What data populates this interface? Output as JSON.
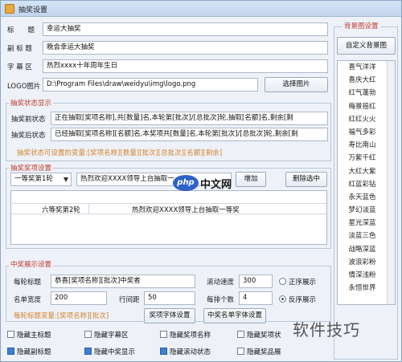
{
  "window": {
    "title": "抽奖设置"
  },
  "basic": {
    "title_label": "标　　题",
    "title_value": "幸运大抽奖",
    "subtitle_label": "副 标 题",
    "subtitle_value": "晚会幸运大抽奖",
    "caption_label": "字 幕 区",
    "caption_value": "热烈xxxx十年周年生日",
    "logo_label": "LOGO图片",
    "logo_path": "D:\\Program Files\\draw\\weidyu\\img\\logo.png",
    "logo_button": "选择图片"
  },
  "draw_status": {
    "group_title": "抽奖状态显示",
    "before_label": "抽奖前状态",
    "before_value": "正在抽取[奖项名称],共[数量]名,本轮第[批次]/[总批次]轮,抽取[名额]名,剩余[剩",
    "after_label": "抽奖后状态",
    "after_value": "已经抽取[奖项名称][名额]名,本奖项共[数量]名,本轮第[批次]/[总批次]轮,剩余[剩",
    "hint": "抽奖状态可设置的变量:[奖项名称][数量][批次][总批次][名额][剩余]"
  },
  "prize_bind": {
    "group_title": "抽奖奖项设置",
    "select_value": "一等奖第1轮",
    "text_value": "热烈欢迎XXXX领导上台抽取一",
    "add_button": "增加",
    "delete_button": "删除选中",
    "table": {
      "col1": "六等奖第2轮",
      "col2": "热烈欢迎XXXX领导上台抽取一等奖"
    }
  },
  "winner_display": {
    "group_title": "中奖展示设置",
    "per_round_label": "每轮标题",
    "per_round_value": "恭喜[奖项名称][批次]中奖者",
    "scroll_speed_label": "滚动速度",
    "scroll_speed_value": "300",
    "name_width_label": "名单宽度",
    "name_width_value": "200",
    "row_spacing_label": "行间距",
    "row_spacing_value": "50",
    "per_row_label": "每排个数",
    "per_row_value": "4",
    "order_asc": "正序展示",
    "order_desc": "反序展示",
    "order_selected": "desc",
    "hint": "每轮标题变量:[奖项名称][批次]",
    "prize_font_button": "奖项字体设置",
    "winner_font_button": "中奖名单字体设置"
  },
  "checks": [
    {
      "label": "隐藏主标题",
      "checked": false
    },
    {
      "label": "隐藏字幕区",
      "checked": false
    },
    {
      "label": "隐藏奖项名称",
      "checked": false
    },
    {
      "label": "隐藏奖项状",
      "checked": false
    },
    {
      "label": "隐藏副标题",
      "checked": true
    },
    {
      "label": "隐藏中奖显示",
      "checked": true
    },
    {
      "label": "隐藏滚动状态",
      "checked": true
    },
    {
      "label": "隐藏奖品展",
      "checked": false
    }
  ],
  "background": {
    "group_title": "背景图设置",
    "custom_button": "自定义背景图",
    "items": [
      "喜气洋洋",
      "喜庆大红",
      "红气蓬勃",
      "梅景摇红",
      "红红火火",
      "福气多彩",
      "寿比南山",
      "万紫千红",
      "大红大紫",
      "红蓝彩钻",
      "永天蓝色",
      "梦幻淡蓝",
      "星光深蓝",
      "淡蓝三色",
      "战略深蓝",
      "波浪彩粉",
      "情深浅粉",
      "永恒世界"
    ]
  },
  "watermark": {
    "php": "php",
    "cn": "中文网",
    "bottom": "软件技巧"
  },
  "colors": {
    "accent": "#c0392b",
    "hint": "#d4822a",
    "window_bg": "#eef2f8"
  }
}
